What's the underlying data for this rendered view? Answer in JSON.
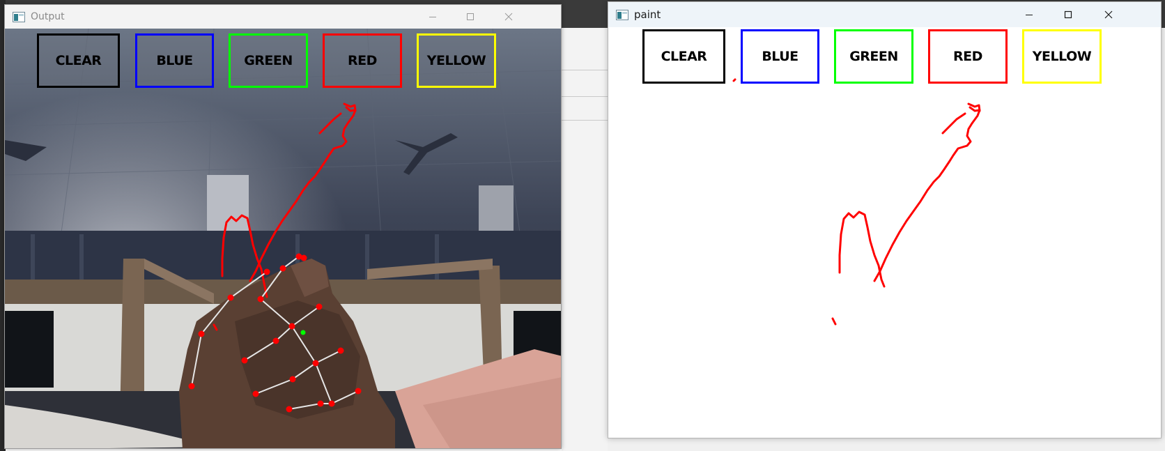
{
  "windows": {
    "output": {
      "title": "Output",
      "buttons": {
        "clear": "CLEAR",
        "blue": "BLUE",
        "green": "GREEN",
        "red": "RED",
        "yellow": "YELLOW"
      }
    },
    "paint": {
      "title": "paint",
      "buttons": {
        "clear": "CLEAR",
        "blue": "BLUE",
        "green": "GREEN",
        "red": "RED",
        "yellow": "YELLOW"
      }
    }
  },
  "colors": {
    "clear": "#000000",
    "blue": "#0000ff",
    "green": "#00ff00",
    "red": "#ff0000",
    "yellow": "#ffff00",
    "stroke": "#ff0000",
    "landmark": "#ff0000",
    "skeleton": "#e6e6e6",
    "fingertip_marker": "#00ff00"
  },
  "icons": {
    "app": "opencv-window-icon",
    "minimize": "minimize-icon",
    "maximize": "maximize-icon",
    "close": "close-icon"
  }
}
